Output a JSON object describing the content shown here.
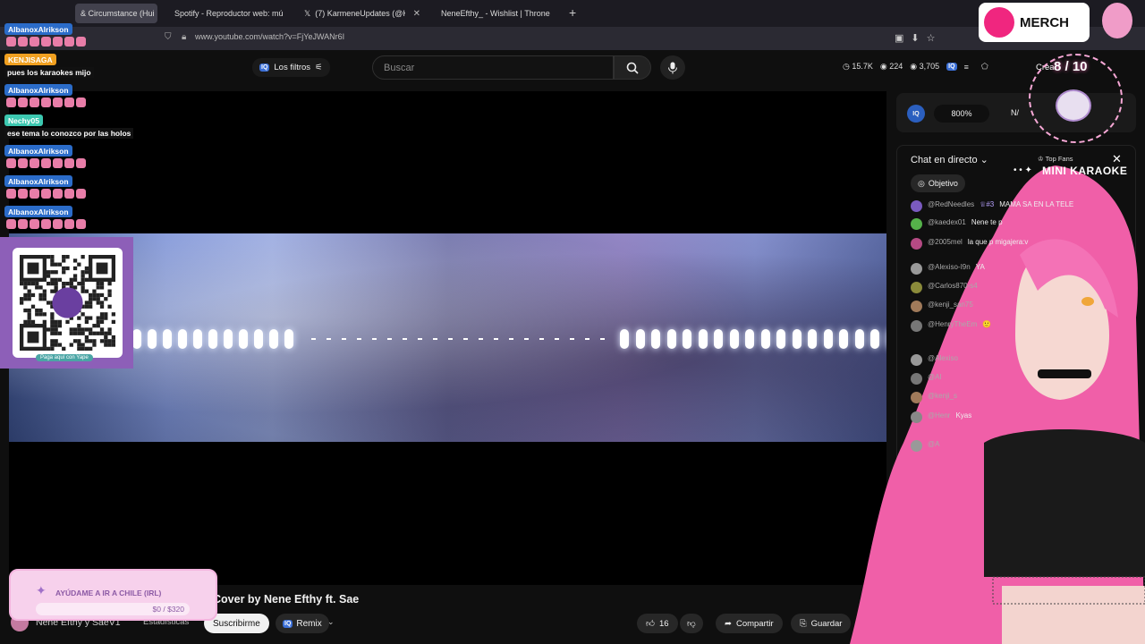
{
  "browser": {
    "tabs": [
      {
        "label": "& Circumstance (Hui",
        "active": true
      },
      {
        "label": "Spotify - Reproductor web: mú"
      },
      {
        "label": "(7) KarmeneUpdates (@Karmen"
      },
      {
        "label": "NeneEfthy_ - Wishlist | Throne"
      }
    ],
    "url": "www.youtube.com/watch?v=FjYeJWANr6I"
  },
  "youtube": {
    "filters_label": "Los filtros",
    "filters_badge": "IQ",
    "search_placeholder": "Buscar",
    "header_stats": {
      "views": "15.7K",
      "users": "224",
      "viewers": "3,705"
    },
    "create_label": "Crea",
    "video": {
      "title_prefix": "Po",
      "title": "Cover by Nene Efthy ft. Sae",
      "channel": "Nene Efthy y SaeV1",
      "stats_label": "Estadísticas",
      "subscribe_label": "Suscribirme",
      "remix_label": "Remix",
      "likes": "16",
      "share_label": "Compartir",
      "save_label": "Guardar"
    },
    "controls": {
      "zoom": "800%",
      "extra": "N/"
    },
    "chat": {
      "header": "Chat en directo",
      "objective_label": "Objetivo",
      "top_fans_label": "Top Fans",
      "messages": [
        {
          "user": "@RedNeedles",
          "badge": "#3",
          "text": "MAMA SA      EN LA TELE"
        },
        {
          "user": "@kaedex01",
          "text": "Nene te p"
        },
        {
          "user": "@2005mel",
          "text": "la que p  migajera:v"
        },
        {
          "user": "@Alexiso-I9n",
          "text": "YA"
        },
        {
          "user": "@Carlos870-s4",
          "text": ""
        },
        {
          "user": "@kenji_san75",
          "text": ""
        },
        {
          "user": "@HenryTheEm",
          "text": "🙂"
        },
        {
          "user": "@Alexiso",
          "text": ""
        },
        {
          "user": "@Al",
          "text": ""
        },
        {
          "user": "@kenji_s",
          "text": ""
        },
        {
          "user": "@Henr",
          "text": "Kyas"
        },
        {
          "user": "@A",
          "text": ""
        }
      ]
    }
  },
  "overlay": {
    "chat": [
      {
        "user": "AlbanoxAlrikson",
        "kind": "emotes"
      },
      {
        "user": "KENJISAGA",
        "text": "pues los karaokes mijo"
      },
      {
        "user": "AlbanoxAlrikson",
        "kind": "emotes"
      },
      {
        "user": "Nechy05",
        "text": "ese tema lo conozco por las holos"
      },
      {
        "user": "AlbanoxAlrikson",
        "kind": "emotes"
      },
      {
        "user": "AlbanoxAlrikson",
        "kind": "emotes"
      },
      {
        "user": "AlbanoxAlrikson",
        "kind": "emotes"
      }
    ],
    "yape_label": "Paga aquí con Yape",
    "donation": {
      "title": "AYÚDAME A IR A CHILE (IRL)",
      "progress": "$0 / $320",
      "fraction": 0
    },
    "merch_label": "MERCH",
    "counter": "8 / 10",
    "karaoke_label": "MINI KARAOKE"
  },
  "colors": {
    "bg": "#0f0f0f",
    "accent_blue": "#2b6cc9",
    "pink": "#f06bb5",
    "yape": "#4aa5a5"
  }
}
